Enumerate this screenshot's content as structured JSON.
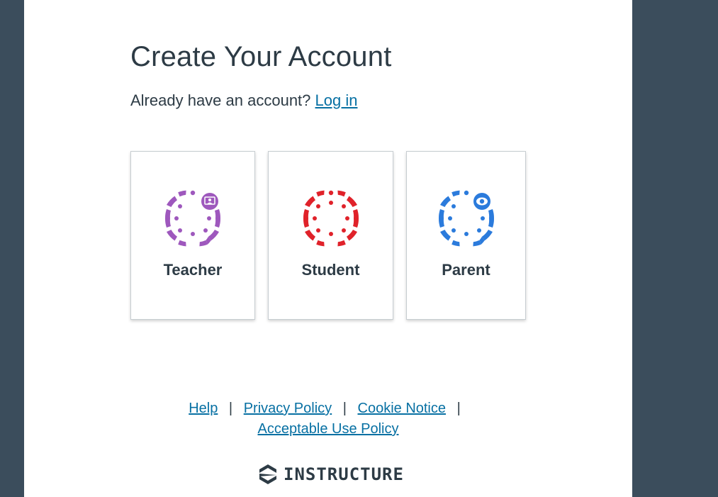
{
  "page": {
    "title": "Create Your Account",
    "already_text": "Already have an account?",
    "login_link": "Log in"
  },
  "roles": [
    {
      "label": "Teacher",
      "color": "#9e58bd",
      "icon": "teacher-icon"
    },
    {
      "label": "Student",
      "color": "#e0222a",
      "icon": "student-icon"
    },
    {
      "label": "Parent",
      "color": "#2b7bdc",
      "icon": "parent-icon"
    }
  ],
  "footer": {
    "help": "Help",
    "privacy": "Privacy Policy",
    "cookie": "Cookie Notice",
    "acceptable_use": "Acceptable Use Policy",
    "separator": "|"
  },
  "brand": {
    "name": "INSTRUCTURE",
    "icon": "instructure-logo-icon"
  }
}
